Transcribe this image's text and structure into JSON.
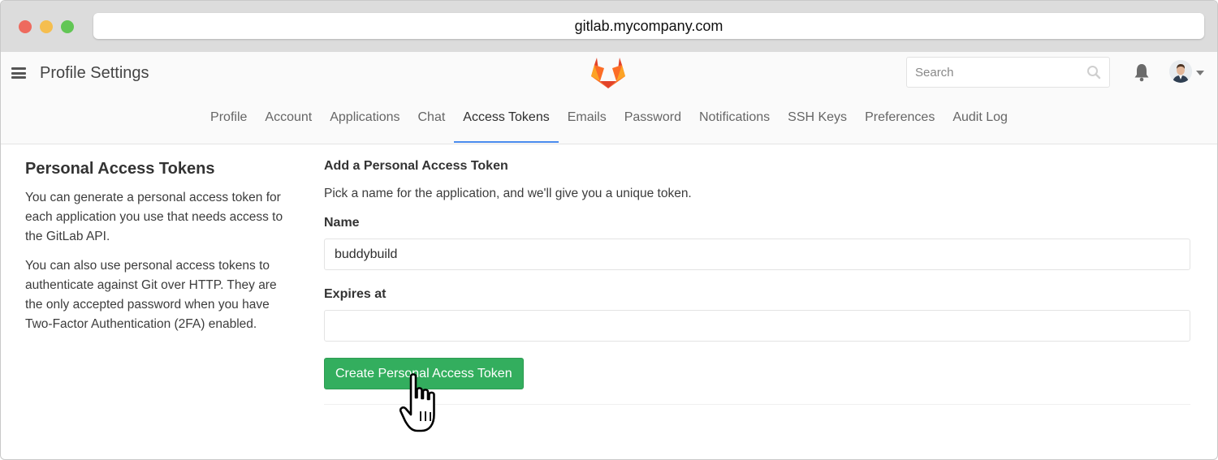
{
  "browser": {
    "url": "gitlab.mycompany.com"
  },
  "header": {
    "title": "Profile Settings",
    "search_placeholder": "Search",
    "icons": [
      "hamburger-icon",
      "gitlab-logo",
      "search-icon",
      "bell-icon",
      "avatar",
      "chevron-down-icon"
    ]
  },
  "tabs": [
    {
      "label": "Profile",
      "active": false
    },
    {
      "label": "Account",
      "active": false
    },
    {
      "label": "Applications",
      "active": false
    },
    {
      "label": "Chat",
      "active": false
    },
    {
      "label": "Access Tokens",
      "active": true
    },
    {
      "label": "Emails",
      "active": false
    },
    {
      "label": "Password",
      "active": false
    },
    {
      "label": "Notifications",
      "active": false
    },
    {
      "label": "SSH Keys",
      "active": false
    },
    {
      "label": "Preferences",
      "active": false
    },
    {
      "label": "Audit Log",
      "active": false
    }
  ],
  "sidebar": {
    "title": "Personal Access Tokens",
    "paragraph1": "You can generate a personal access token for each application you use that needs access to the GitLab API.",
    "paragraph2": "You can also use personal access tokens to authenticate against Git over HTTP. They are the only accepted password when you have Two-Factor Authentication (2FA) enabled."
  },
  "form": {
    "heading": "Add a Personal Access Token",
    "description": "Pick a name for the application, and we'll give you a unique token.",
    "name_label": "Name",
    "name_value": "buddybuild",
    "expires_label": "Expires at",
    "expires_value": "",
    "submit_label": "Create Personal Access Token"
  },
  "colors": {
    "accent_tab_underline": "#4a8bee",
    "primary_button": "#33ae5e",
    "logo_orange": "#fc6d26",
    "logo_red": "#e24329"
  }
}
